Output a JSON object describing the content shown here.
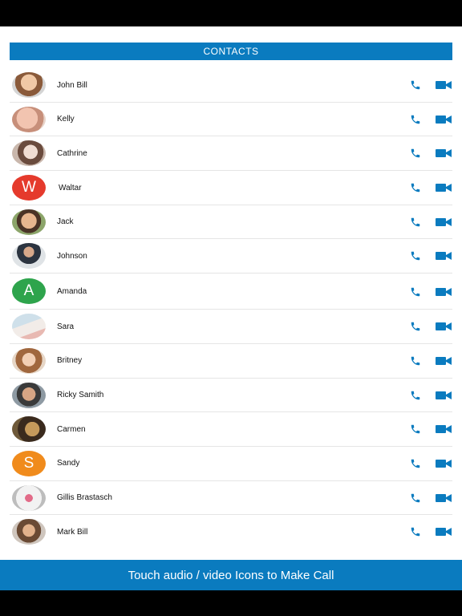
{
  "header": {
    "title": "CONTACTS"
  },
  "contacts": [
    {
      "name": "John Bill",
      "avatar": "photo"
    },
    {
      "name": "Kelly",
      "avatar": "photo"
    },
    {
      "name": "Cathrine",
      "avatar": "photo"
    },
    {
      "name": "Waltar",
      "avatar": "letter",
      "initial": "W",
      "color": "#e53a2c"
    },
    {
      "name": "Jack",
      "avatar": "photo"
    },
    {
      "name": "Johnson",
      "avatar": "photo"
    },
    {
      "name": "Amanda",
      "avatar": "letter",
      "initial": "A",
      "color": "#2ea44c"
    },
    {
      "name": "Sara",
      "avatar": "photo"
    },
    {
      "name": "Britney",
      "avatar": "photo"
    },
    {
      "name": "Ricky Samith",
      "avatar": "photo"
    },
    {
      "name": "Carmen",
      "avatar": "photo"
    },
    {
      "name": "Sandy",
      "avatar": "letter",
      "initial": "S",
      "color": "#f08b1c"
    },
    {
      "name": "Gillis Brastasch",
      "avatar": "photo"
    },
    {
      "name": "Mark Bill",
      "avatar": "photo"
    }
  ],
  "icons": {
    "audio": "phone-icon",
    "video": "video-camera-icon"
  },
  "colors": {
    "accent": "#0a7bbf"
  },
  "footer": {
    "hint": "Touch audio / video Icons to Make Call"
  }
}
